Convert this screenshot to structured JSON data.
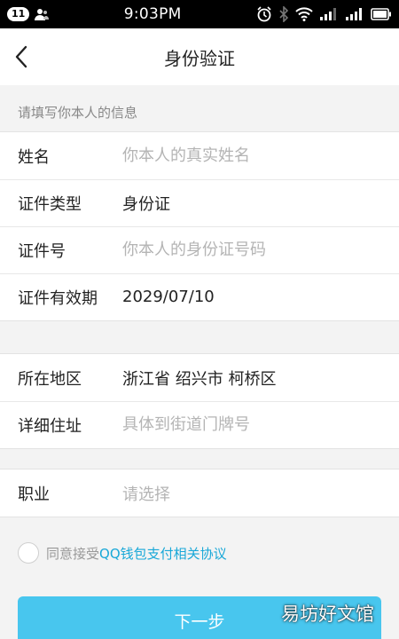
{
  "status_bar": {
    "notification_count": "11",
    "time": "9:03PM"
  },
  "header": {
    "title": "身份验证"
  },
  "section_hint": "请填写你本人的信息",
  "identity_fields": [
    {
      "label": "姓名",
      "value": "",
      "placeholder": "你本人的真实姓名"
    },
    {
      "label": "证件类型",
      "value": "身份证"
    },
    {
      "label": "证件号",
      "value": "",
      "placeholder": "你本人的身份证号码"
    },
    {
      "label": "证件有效期",
      "value": "2029/07/10"
    }
  ],
  "address_fields": [
    {
      "label": "所在地区",
      "value": "浙江省 绍兴市 柯桥区"
    },
    {
      "label": "详细住址",
      "value": "",
      "placeholder": "具体到街道门牌号"
    }
  ],
  "job_field": {
    "label": "职业",
    "value": "请选择"
  },
  "agreement": {
    "prefix": "同意接受",
    "link_text": "QQ钱包支付相关协议"
  },
  "next_button": {
    "label": "下一步"
  },
  "watermark": "易坊好文馆",
  "colors": {
    "accent": "#48c6ee",
    "link": "#19a8d8",
    "placeholder": "#b4b4b4"
  }
}
